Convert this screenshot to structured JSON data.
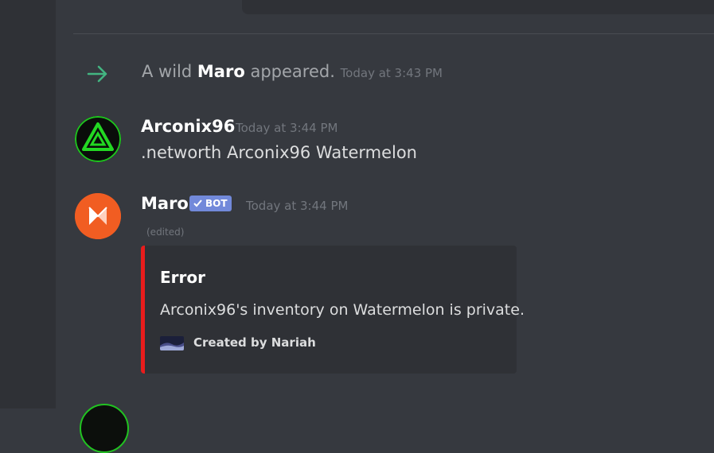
{
  "system_message": {
    "prefix": "A wild",
    "name": "Maro",
    "suffix": "appeared.",
    "timestamp": "Today at 3:43 PM"
  },
  "messages": [
    {
      "author": "Arconix96",
      "timestamp": "Today at 3:44 PM",
      "content": ".networth Arconix96 Watermelon"
    },
    {
      "author": "Maro",
      "badge": "BOT",
      "timestamp": "Today at 3:44 PM",
      "edited_label": "(edited)",
      "embed": {
        "title": "Error",
        "description": "Arconix96's inventory on Watermelon is private.",
        "footer": "Created by Nariah",
        "accent_color": "#e91c1c"
      }
    }
  ],
  "colors": {
    "background": "#36393f",
    "sidebar": "#2f3136",
    "join_arrow": "#43b581",
    "bot_badge": "#7289da"
  },
  "icons": {
    "join": "arrow-right-icon",
    "badge_check": "checkmark-icon"
  }
}
